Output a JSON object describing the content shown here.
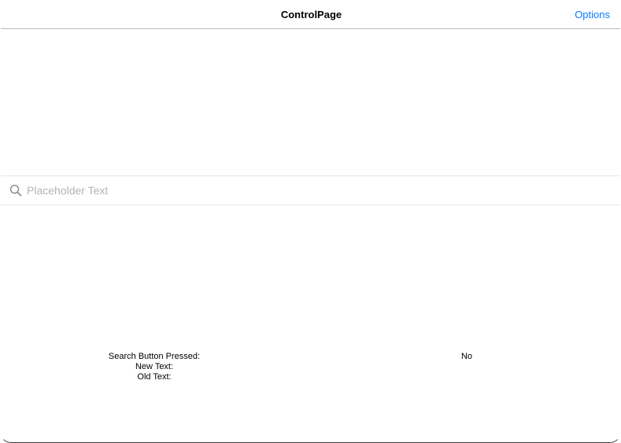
{
  "nav": {
    "title": "ControlPage",
    "options_label": "Options"
  },
  "search": {
    "placeholder": "Placeholder Text",
    "value": "",
    "icon": "search-icon"
  },
  "status": {
    "search_button_pressed_label": "Search Button Pressed:",
    "search_button_pressed_value": "No",
    "new_text_label": "New Text:",
    "new_text_value": "",
    "old_text_label": "Old Text:",
    "old_text_value": ""
  },
  "colors": {
    "accent": "#0a7aff",
    "placeholder": "#b3b3b8",
    "separator": "#b8b8bc"
  }
}
